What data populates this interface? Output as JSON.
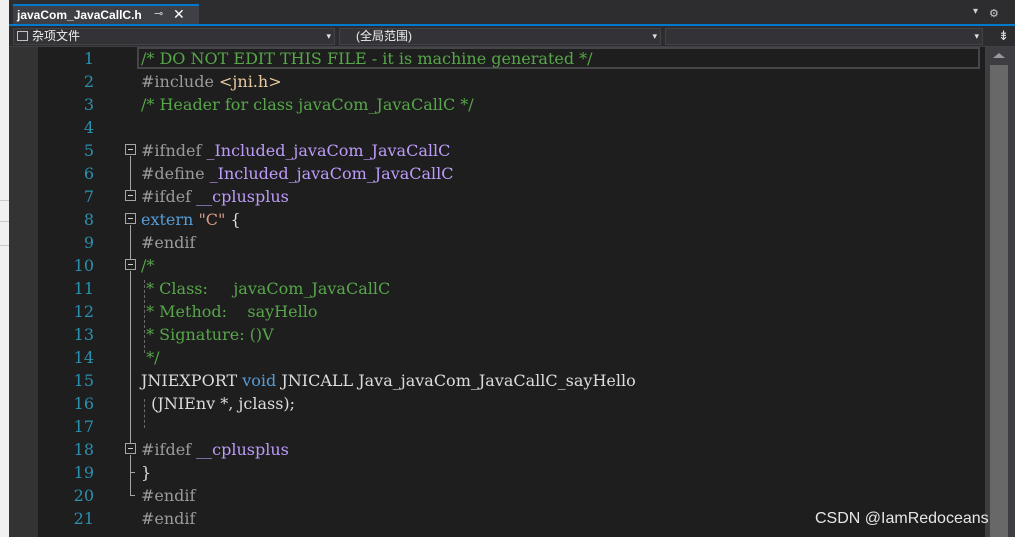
{
  "tab": {
    "title": "javaCom_JavaCallC.h",
    "pin_glyph": "⊸",
    "close_glyph": "✕"
  },
  "toolbar": {
    "dropdown_glyph": "▾",
    "settings_glyph": "⚙"
  },
  "navbar": {
    "project_combo": "杂项文件",
    "scope_combo": "(全局范围)",
    "member_combo": "",
    "arrow_glyph": "▾",
    "split_glyph": "⇟"
  },
  "editor": {
    "line_numbers": [
      "1",
      "2",
      "3",
      "4",
      "5",
      "6",
      "7",
      "8",
      "9",
      "10",
      "11",
      "12",
      "13",
      "14",
      "15",
      "16",
      "17",
      "18",
      "19",
      "20",
      "21"
    ],
    "lines": [
      [
        {
          "t": "/* DO NOT EDIT THIS FILE - it is machine generated */",
          "c": "com"
        }
      ],
      [
        {
          "t": "#include ",
          "c": "pre"
        },
        {
          "t": "<jni.h>",
          "c": "inc"
        }
      ],
      [
        {
          "t": "/* Header for class javaCom_JavaCallC */",
          "c": "com"
        }
      ],
      [],
      [
        {
          "t": "#ifndef ",
          "c": "pre"
        },
        {
          "t": "_Included_javaCom_JavaCallC",
          "c": "mac"
        }
      ],
      [
        {
          "t": "#define ",
          "c": "pre"
        },
        {
          "t": "_Included_javaCom_JavaCallC",
          "c": "mac"
        }
      ],
      [
        {
          "t": "#ifdef ",
          "c": "pre"
        },
        {
          "t": "__cplusplus",
          "c": "mac"
        }
      ],
      [
        {
          "t": "extern ",
          "c": "kw"
        },
        {
          "t": "\"C\"",
          "c": "str"
        },
        {
          "t": " {",
          "c": "txt"
        }
      ],
      [
        {
          "t": "#endif",
          "c": "pre"
        }
      ],
      [
        {
          "t": "/*",
          "c": "com"
        }
      ],
      [
        {
          "t": " * Class:     javaCom_JavaCallC",
          "c": "com"
        }
      ],
      [
        {
          "t": " * Method:    sayHello",
          "c": "com"
        }
      ],
      [
        {
          "t": " * Signature: ()V",
          "c": "com"
        }
      ],
      [
        {
          "t": " */",
          "c": "com"
        }
      ],
      [
        {
          "t": "JNIEXPORT ",
          "c": "txt"
        },
        {
          "t": "void",
          "c": "kw"
        },
        {
          "t": " JNICALL Java_javaCom_JavaCallC_sayHello",
          "c": "txt"
        }
      ],
      [
        {
          "t": "  (JNIEnv *, jclass);",
          "c": "txt"
        }
      ],
      [],
      [
        {
          "t": "#ifdef ",
          "c": "pre"
        },
        {
          "t": "__cplusplus",
          "c": "mac"
        }
      ],
      [
        {
          "t": "}",
          "c": "txt"
        }
      ],
      [
        {
          "t": "#endif",
          "c": "pre"
        }
      ],
      [
        {
          "t": "#endif",
          "c": "pre"
        }
      ]
    ]
  },
  "colors": {
    "comment": "#57a64a",
    "preprocessor": "#9b9b9b",
    "keyword": "#569cd6",
    "string": "#d69d85",
    "macro": "#bd9bf8",
    "line_number": "#2b91af",
    "accent": "#007acc"
  },
  "watermark": "CSDN @IamRedoceans"
}
